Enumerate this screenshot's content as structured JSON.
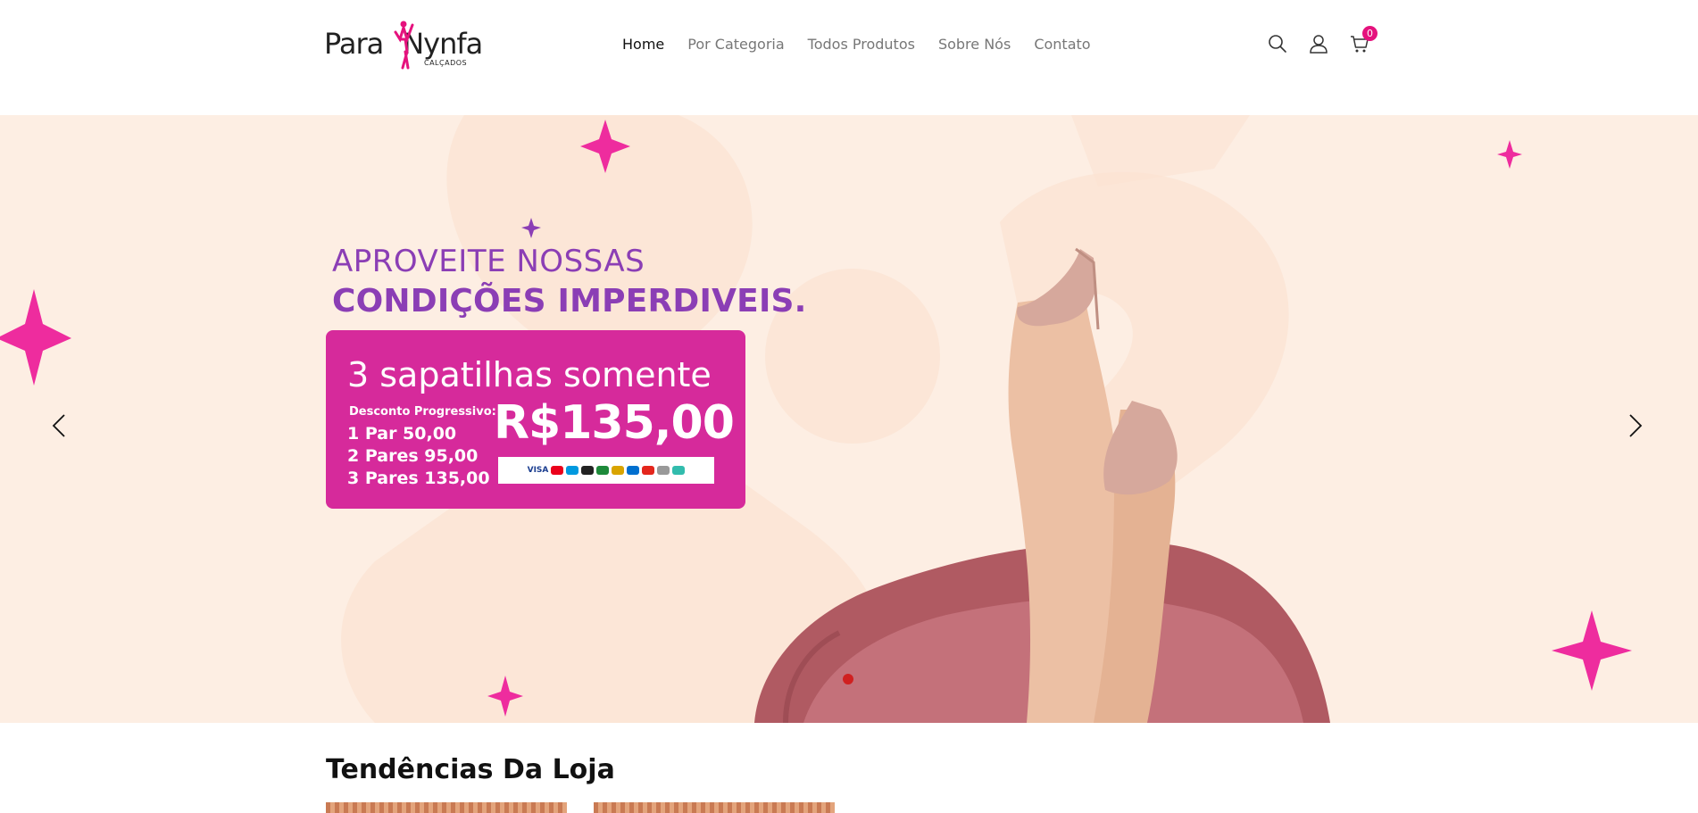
{
  "header": {
    "logo": {
      "primary": "Para",
      "secondary": "Nynfa",
      "tagline": "CALÇADOS"
    },
    "nav": [
      {
        "label": "Home",
        "active": true
      },
      {
        "label": "Por Categoria",
        "active": false
      },
      {
        "label": "Todos Produtos",
        "active": false
      },
      {
        "label": "Sobre Nós",
        "active": false
      },
      {
        "label": "Contato",
        "active": false
      }
    ],
    "icons": {
      "search": "search-icon",
      "account": "user-icon",
      "cart": "cart-icon"
    },
    "cart_count": "0"
  },
  "hero": {
    "headline_line1": "APROVEITE NOSSAS",
    "headline_line2": "CONDIÇÕES IMPERDIVEIS.",
    "promo": {
      "title": "3 sapatilhas somente",
      "subtitle": "Desconto Progressivo:",
      "tiers": [
        "1 Par 50,00",
        "2 Pares 95,00",
        "3 Pares 135,00"
      ],
      "price": "R$135,00",
      "payment_label": "VISA"
    },
    "slide_active": 1,
    "slide_count": 1
  },
  "section": {
    "title": "Tendências Da Loja"
  },
  "colors": {
    "brand_pink": "#e5127d",
    "promo_bg": "#d62a9b",
    "headline_purple": "#8b3eb5",
    "hero_bg": "#fdeee3",
    "slider_dot": "#d02020"
  }
}
